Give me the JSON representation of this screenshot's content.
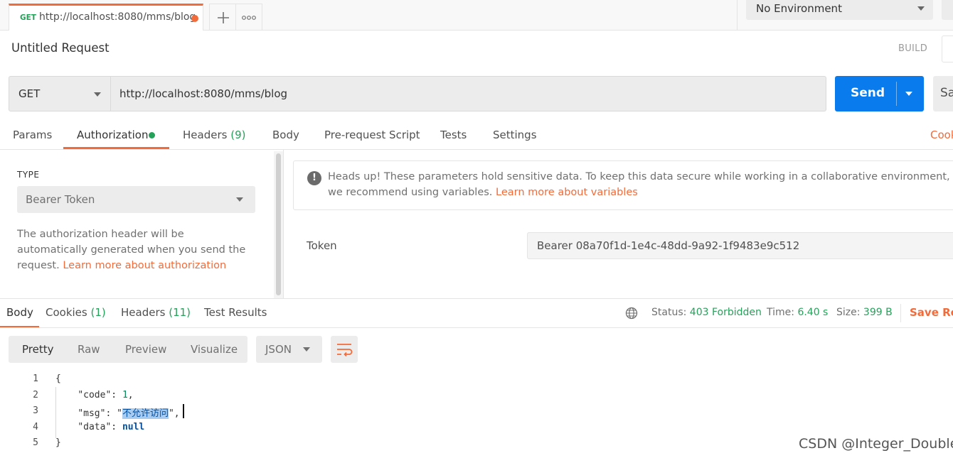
{
  "top_tabs": {
    "active": {
      "method": "GET",
      "url": "http://localhost:8080/mms/blog"
    },
    "new_tab_icon": "plus-icon",
    "more_icon": "ellipsis-icon"
  },
  "environment": {
    "selected": "No Environment"
  },
  "request": {
    "title": "Untitled Request",
    "build_label": "BUILD",
    "method": "GET",
    "url": "http://localhost:8080/mms/blog",
    "send_label": "Send",
    "save_label": "Sa"
  },
  "request_tabs": [
    {
      "label": "Params"
    },
    {
      "label": "Authorization"
    },
    {
      "label": "Headers",
      "count": "(9)"
    },
    {
      "label": "Body"
    },
    {
      "label": "Pre-request Script"
    },
    {
      "label": "Tests"
    },
    {
      "label": "Settings"
    }
  ],
  "cookies_link": "Cook",
  "auth": {
    "type_label": "TYPE",
    "type_value": "Bearer Token",
    "description": "The authorization header will be automatically generated when you send the request. ",
    "description_link": "Learn more about authorization",
    "heads_up": "Heads up! These parameters hold sensitive data. To keep this data secure while working in a collaborative environment, we recommend using variables. ",
    "heads_up_link": "Learn more about variables",
    "token_label": "Token",
    "token_value": "Bearer 08a70f1d-1e4c-48dd-9a92-1f9483e9c512"
  },
  "response_tabs": [
    {
      "label": "Body"
    },
    {
      "label": "Cookies",
      "count": "(1)"
    },
    {
      "label": "Headers",
      "count": "(11)"
    },
    {
      "label": "Test Results"
    }
  ],
  "response_status": {
    "status_label": "Status:",
    "status_value": "403 Forbidden",
    "time_label": "Time:",
    "time_value": "6.40 s",
    "size_label": "Size:",
    "size_value": "399 B",
    "save_label": "Save Res"
  },
  "format_modes": [
    "Pretty",
    "Raw",
    "Preview",
    "Visualize"
  ],
  "language": "JSON",
  "code": {
    "line_numbers": [
      "1",
      "2",
      "3",
      "4",
      "5"
    ],
    "open_brace": "{",
    "code_key": "\"code\"",
    "code_value": "1",
    "msg_key": "\"msg\"",
    "msg_value": "不允许访问",
    "data_key": "\"data\"",
    "data_value": "null",
    "close_brace": "}"
  },
  "watermark": "CSDN @Integer_Double",
  "colors": {
    "accent": "#f26b3a",
    "send_blue": "#097bed",
    "success_green": "#26a15a"
  }
}
